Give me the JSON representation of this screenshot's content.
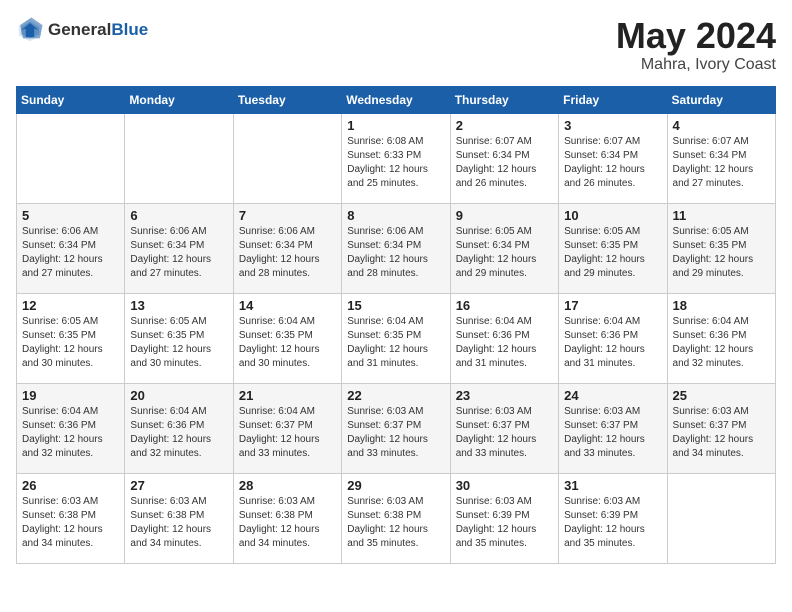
{
  "logo": {
    "general": "General",
    "blue": "Blue"
  },
  "title": "May 2024",
  "location": "Mahra, Ivory Coast",
  "weekdays": [
    "Sunday",
    "Monday",
    "Tuesday",
    "Wednesday",
    "Thursday",
    "Friday",
    "Saturday"
  ],
  "weeks": [
    [
      {
        "day": "",
        "info": ""
      },
      {
        "day": "",
        "info": ""
      },
      {
        "day": "",
        "info": ""
      },
      {
        "day": "1",
        "info": "Sunrise: 6:08 AM\nSunset: 6:33 PM\nDaylight: 12 hours\nand 25 minutes."
      },
      {
        "day": "2",
        "info": "Sunrise: 6:07 AM\nSunset: 6:34 PM\nDaylight: 12 hours\nand 26 minutes."
      },
      {
        "day": "3",
        "info": "Sunrise: 6:07 AM\nSunset: 6:34 PM\nDaylight: 12 hours\nand 26 minutes."
      },
      {
        "day": "4",
        "info": "Sunrise: 6:07 AM\nSunset: 6:34 PM\nDaylight: 12 hours\nand 27 minutes."
      }
    ],
    [
      {
        "day": "5",
        "info": "Sunrise: 6:06 AM\nSunset: 6:34 PM\nDaylight: 12 hours\nand 27 minutes."
      },
      {
        "day": "6",
        "info": "Sunrise: 6:06 AM\nSunset: 6:34 PM\nDaylight: 12 hours\nand 27 minutes."
      },
      {
        "day": "7",
        "info": "Sunrise: 6:06 AM\nSunset: 6:34 PM\nDaylight: 12 hours\nand 28 minutes."
      },
      {
        "day": "8",
        "info": "Sunrise: 6:06 AM\nSunset: 6:34 PM\nDaylight: 12 hours\nand 28 minutes."
      },
      {
        "day": "9",
        "info": "Sunrise: 6:05 AM\nSunset: 6:34 PM\nDaylight: 12 hours\nand 29 minutes."
      },
      {
        "day": "10",
        "info": "Sunrise: 6:05 AM\nSunset: 6:35 PM\nDaylight: 12 hours\nand 29 minutes."
      },
      {
        "day": "11",
        "info": "Sunrise: 6:05 AM\nSunset: 6:35 PM\nDaylight: 12 hours\nand 29 minutes."
      }
    ],
    [
      {
        "day": "12",
        "info": "Sunrise: 6:05 AM\nSunset: 6:35 PM\nDaylight: 12 hours\nand 30 minutes."
      },
      {
        "day": "13",
        "info": "Sunrise: 6:05 AM\nSunset: 6:35 PM\nDaylight: 12 hours\nand 30 minutes."
      },
      {
        "day": "14",
        "info": "Sunrise: 6:04 AM\nSunset: 6:35 PM\nDaylight: 12 hours\nand 30 minutes."
      },
      {
        "day": "15",
        "info": "Sunrise: 6:04 AM\nSunset: 6:35 PM\nDaylight: 12 hours\nand 31 minutes."
      },
      {
        "day": "16",
        "info": "Sunrise: 6:04 AM\nSunset: 6:36 PM\nDaylight: 12 hours\nand 31 minutes."
      },
      {
        "day": "17",
        "info": "Sunrise: 6:04 AM\nSunset: 6:36 PM\nDaylight: 12 hours\nand 31 minutes."
      },
      {
        "day": "18",
        "info": "Sunrise: 6:04 AM\nSunset: 6:36 PM\nDaylight: 12 hours\nand 32 minutes."
      }
    ],
    [
      {
        "day": "19",
        "info": "Sunrise: 6:04 AM\nSunset: 6:36 PM\nDaylight: 12 hours\nand 32 minutes."
      },
      {
        "day": "20",
        "info": "Sunrise: 6:04 AM\nSunset: 6:36 PM\nDaylight: 12 hours\nand 32 minutes."
      },
      {
        "day": "21",
        "info": "Sunrise: 6:04 AM\nSunset: 6:37 PM\nDaylight: 12 hours\nand 33 minutes."
      },
      {
        "day": "22",
        "info": "Sunrise: 6:03 AM\nSunset: 6:37 PM\nDaylight: 12 hours\nand 33 minutes."
      },
      {
        "day": "23",
        "info": "Sunrise: 6:03 AM\nSunset: 6:37 PM\nDaylight: 12 hours\nand 33 minutes."
      },
      {
        "day": "24",
        "info": "Sunrise: 6:03 AM\nSunset: 6:37 PM\nDaylight: 12 hours\nand 33 minutes."
      },
      {
        "day": "25",
        "info": "Sunrise: 6:03 AM\nSunset: 6:37 PM\nDaylight: 12 hours\nand 34 minutes."
      }
    ],
    [
      {
        "day": "26",
        "info": "Sunrise: 6:03 AM\nSunset: 6:38 PM\nDaylight: 12 hours\nand 34 minutes."
      },
      {
        "day": "27",
        "info": "Sunrise: 6:03 AM\nSunset: 6:38 PM\nDaylight: 12 hours\nand 34 minutes."
      },
      {
        "day": "28",
        "info": "Sunrise: 6:03 AM\nSunset: 6:38 PM\nDaylight: 12 hours\nand 34 minutes."
      },
      {
        "day": "29",
        "info": "Sunrise: 6:03 AM\nSunset: 6:38 PM\nDaylight: 12 hours\nand 35 minutes."
      },
      {
        "day": "30",
        "info": "Sunrise: 6:03 AM\nSunset: 6:39 PM\nDaylight: 12 hours\nand 35 minutes."
      },
      {
        "day": "31",
        "info": "Sunrise: 6:03 AM\nSunset: 6:39 PM\nDaylight: 12 hours\nand 35 minutes."
      },
      {
        "day": "",
        "info": ""
      }
    ]
  ]
}
